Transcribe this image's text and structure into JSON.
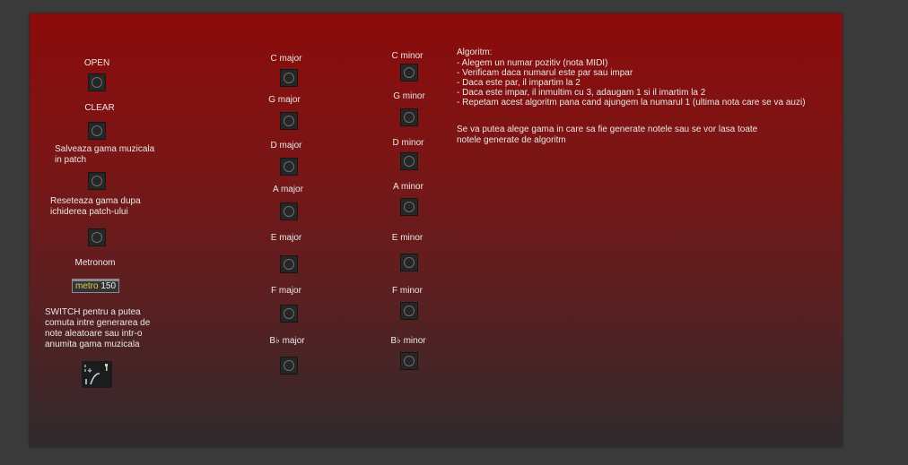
{
  "left_column": {
    "open_label": "OPEN",
    "clear_label": "CLEAR",
    "save_label": "Salveaza gama muzicala\nin patch",
    "reset_label": "Reseteaza gama dupa\nichiderea patch-ului",
    "metronome_label": "Metronom",
    "metro_object": {
      "keyword": "metro",
      "value": "150"
    },
    "switch_label": "SWITCH pentru a putea\ncomuta intre generarea de\nnote aleatoare sau intr-o\nanumita gama muzicala"
  },
  "major_scales": [
    "C major",
    "G major",
    "D major",
    "A major",
    "E major",
    "F major",
    "B♭ major"
  ],
  "minor_scales": [
    "C minor",
    "G minor",
    "D minor",
    "A minor",
    "E minor",
    "F minor",
    "B♭ minor"
  ],
  "algorithm": {
    "title": "Algoritm:",
    "steps": [
      "- Alegem un numar pozitiv (nota MIDI)",
      "- Verificam daca numarul este par sau impar",
      "- Daca este par, il impartim la 2",
      "- Daca este impar, il inmultim cu 3, adaugam 1 si il imartim la 2",
      "- Repetam acest algoritm pana cand ajungem la numarul 1 (ultima nota care se va auzi)"
    ],
    "note": "Se va putea alege gama in care sa fie generate notele sau se vor lasa toate\nnotele generate de algoritm"
  },
  "colors": {
    "background_top": "#8c0b0b",
    "background_bottom": "#2f2a2c",
    "metro_keyword": "#e8c85a"
  }
}
